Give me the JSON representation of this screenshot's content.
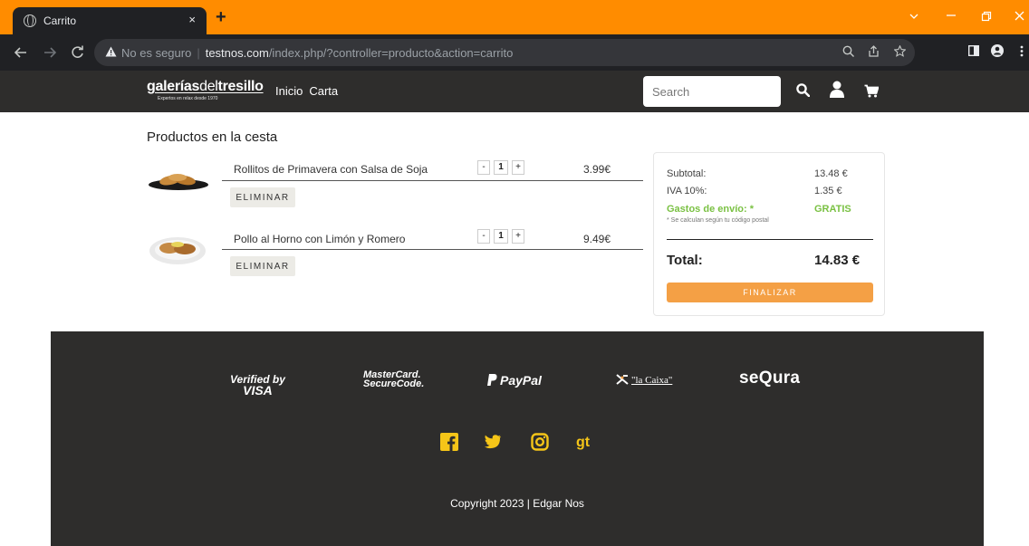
{
  "browser": {
    "tab_title": "Carrito",
    "close_glyph": "×",
    "newtab_glyph": "+",
    "security_label": "No es seguro",
    "url_host": "testnos.com",
    "url_path": "/index.php/?controller=producto&action=carrito"
  },
  "header": {
    "logo_bold": "galerías",
    "logo_light": "del",
    "logo_bold2": "tresillo",
    "logo_tagline": "Expertos en relax desde 1970",
    "menu": [
      "Inicio",
      "Carta"
    ],
    "search_placeholder": "Search"
  },
  "cart": {
    "title": "Productos en la cesta",
    "remove_label": "ELIMINAR",
    "items": [
      {
        "name": "Rollitos de Primavera con Salsa de Soja",
        "qty": "1",
        "minus": "-",
        "plus": "+",
        "price": "3.99€"
      },
      {
        "name": "Pollo al Horno con Limón y Romero",
        "qty": "1",
        "minus": "-",
        "plus": "+",
        "price": "9.49€"
      }
    ]
  },
  "summary": {
    "subtotal_label": "Subtotal:",
    "subtotal_value": "13.48 €",
    "iva_label": "IVA 10%:",
    "iva_value": "1.35 €",
    "shipping_label": "Gastos de envío: *",
    "shipping_value": "GRATIS",
    "note": "* Se calculan según tu código postal",
    "total_label": "Total:",
    "total_value": "14.83 €",
    "finalize_label": "FINALIZAR"
  },
  "footer": {
    "payments": {
      "visa_top": "Verified by",
      "visa_bottom": "VISA",
      "mc_top": "MasterCard.",
      "mc_bottom": "SecureCode.",
      "paypal": "PayPal",
      "caixa": "\"la Caixa\"",
      "sequra": "seQura"
    },
    "copyright": "Copyright 2023 | Edgar Nos"
  },
  "colors": {
    "tabbar": "#ff8c00",
    "header": "#2e2d2c",
    "accent_orange": "#f4a045",
    "social_yellow": "#f5c518",
    "shipping_green": "#7ac143"
  }
}
